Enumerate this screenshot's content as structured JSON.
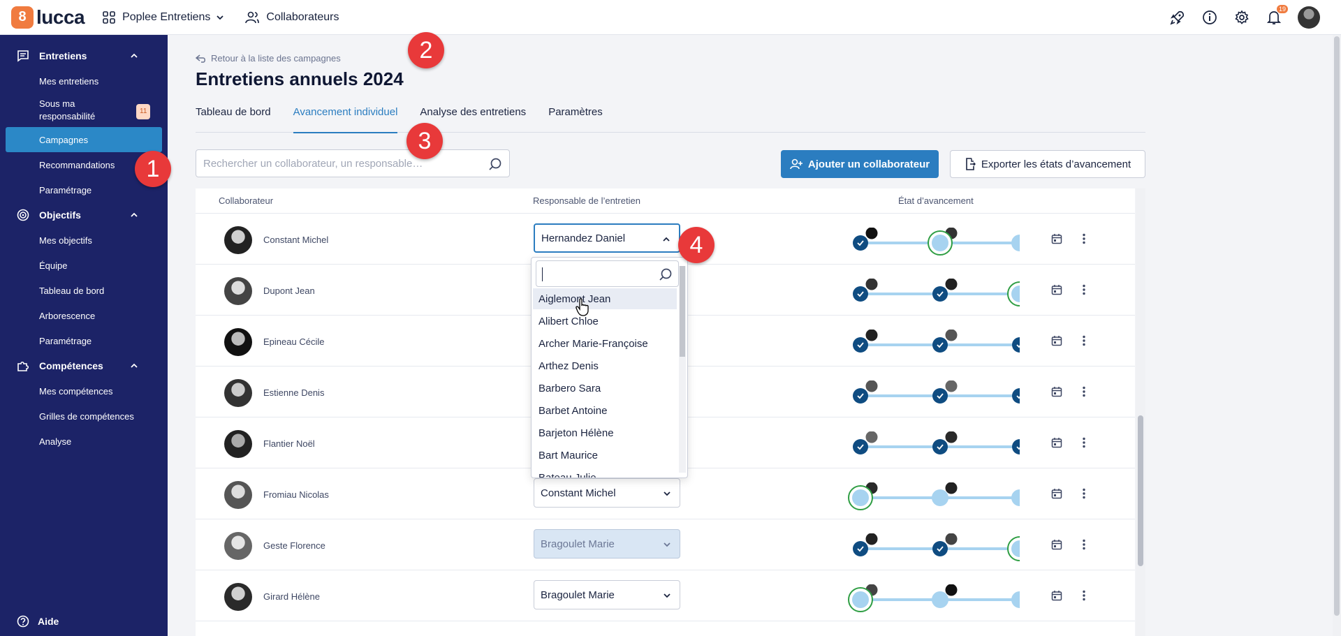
{
  "topbar": {
    "logo_letter": "8",
    "logo_text": "lucca",
    "app_name": "Poplee Entretiens",
    "people_label": "Collaborateurs",
    "notif_count": "19"
  },
  "sidebar": {
    "sections": [
      {
        "label": "Entretiens",
        "items": [
          "Mes entretiens",
          "Sous ma responsabilité",
          "Campagnes",
          "Recommandations",
          "Paramétrage"
        ],
        "badge": "11"
      },
      {
        "label": "Objectifs",
        "items": [
          "Mes objectifs",
          "Équipe",
          "Tableau de bord",
          "Arborescence",
          "Paramétrage"
        ]
      },
      {
        "label": "Compétences",
        "items": [
          "Mes compétences",
          "Grilles de compétences",
          "Analyse"
        ]
      }
    ],
    "sous_line1": "Sous ma",
    "sous_line2": "responsabilité",
    "help": "Aide"
  },
  "main": {
    "back_link": "Retour à la liste des campagnes",
    "title": "Entretiens annuels 2024",
    "tabs": [
      "Tableau de bord",
      "Avancement individuel",
      "Analyse des entretiens",
      "Paramètres"
    ],
    "search_placeholder": "Rechercher un collaborateur, un responsable…",
    "add_button": "Ajouter un collaborateur",
    "export_button": "Exporter les états d’avancement"
  },
  "table": {
    "headers": [
      "Collaborateur",
      "Responsable de l’entretien",
      "État d’avancement"
    ],
    "rows": [
      {
        "name": "Constant Michel",
        "manager": "Hernandez Daniel",
        "state": "open",
        "progress": [
          "done",
          "current",
          "todo"
        ]
      },
      {
        "name": "Dupont Jean",
        "manager": "",
        "state": "hidden",
        "progress": [
          "done",
          "done",
          "current"
        ]
      },
      {
        "name": "Epineau Cécile",
        "manager": "",
        "state": "hidden",
        "progress": [
          "done",
          "done",
          "done"
        ]
      },
      {
        "name": "Estienne Denis",
        "manager": "",
        "state": "hidden",
        "progress": [
          "done",
          "done",
          "done"
        ]
      },
      {
        "name": "Flantier Noël",
        "manager": "",
        "state": "hidden",
        "progress": [
          "done",
          "done",
          "done"
        ]
      },
      {
        "name": "Fromiau Nicolas",
        "manager": "Constant Michel",
        "state": "normal",
        "progress": [
          "current",
          "todo",
          "todo"
        ]
      },
      {
        "name": "Geste Florence",
        "manager": "Bragoulet Marie",
        "state": "disabled",
        "progress": [
          "done",
          "done",
          "current"
        ]
      },
      {
        "name": "Girard Hélène",
        "manager": "Bragoulet Marie",
        "state": "normal",
        "progress": [
          "current",
          "todo",
          "todo"
        ]
      }
    ]
  },
  "dropdown": {
    "options": [
      "Aiglemont Jean",
      "Alibert Chloe",
      "Archer Marie-Françoise",
      "Arthez Denis",
      "Barbero Sara",
      "Barbet Antoine",
      "Barjeton Hélène",
      "Bart Maurice",
      "Bateau Julie"
    ]
  },
  "markers": [
    "1",
    "2",
    "3",
    "4"
  ],
  "colors": {
    "sidebar": "#1c2367",
    "primary": "#2b7dc0",
    "accent": "#f07b3f",
    "marker": "#e8393a",
    "progress_done": "#0f4c81",
    "progress_line": "#a7d3f0",
    "progress_current": "#2f9e44"
  }
}
